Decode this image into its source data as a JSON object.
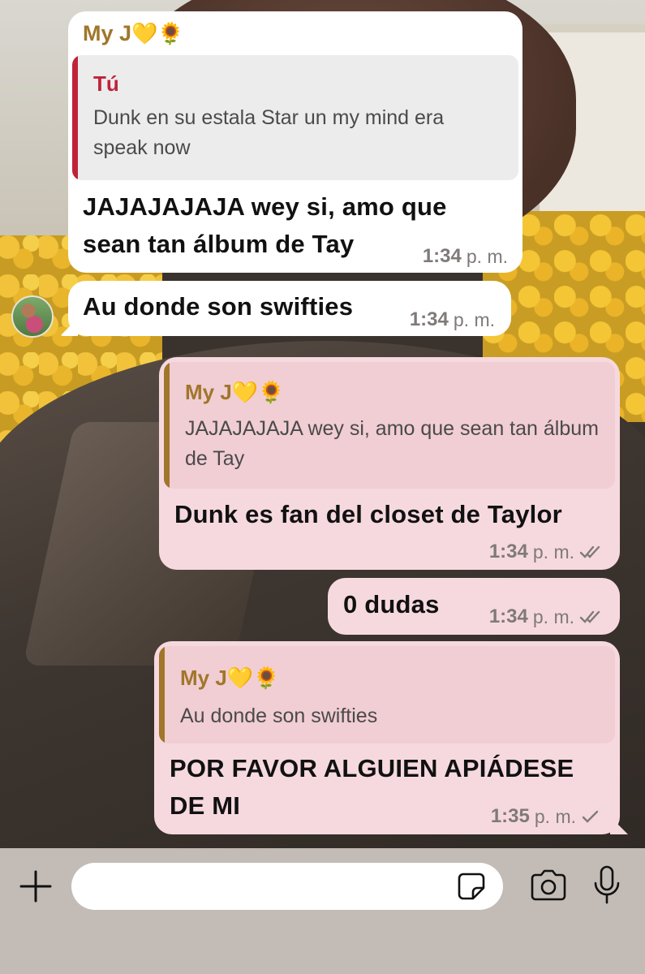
{
  "chat": {
    "messages": [
      {
        "direction": "incoming",
        "sender": "My J",
        "sender_emoji": "💛🌻",
        "quote": {
          "name": "Tú",
          "text": "Dunk en su estala Star un my mind era speak now"
        },
        "text": "JAJAJAJAJA wey si, amo que sean tan álbum de Tay",
        "time": "1:34",
        "ampm": "p. m."
      },
      {
        "direction": "incoming",
        "text": "Au donde son swifties",
        "time": "1:34",
        "ampm": "p. m."
      },
      {
        "direction": "outgoing",
        "quote": {
          "name": "My J",
          "name_emoji": "💛🌻",
          "text": "JAJAJAJAJA wey si, amo que sean tan álbum de Tay"
        },
        "text": "Dunk es fan del closet de Taylor",
        "time": "1:34",
        "ampm": "p. m.",
        "status": "read"
      },
      {
        "direction": "outgoing",
        "text": "0 dudas",
        "time": "1:34",
        "ampm": "p. m.",
        "status": "read"
      },
      {
        "direction": "outgoing",
        "quote": {
          "name": "My J",
          "name_emoji": "💛🌻",
          "text": "Au donde son swifties"
        },
        "text": "POR FAVOR ALGUIEN APIÁDESE DE MI",
        "time": "1:35",
        "ampm": "p. m.",
        "status": "sent"
      }
    ]
  },
  "input_bar": {
    "placeholder": "",
    "icons": [
      "plus-icon",
      "sticker-icon",
      "camera-icon",
      "microphone-icon"
    ]
  },
  "colors": {
    "incoming_bubble": "#ffffff",
    "outgoing_bubble": "#f6d9df",
    "sender_name": "#a0762a",
    "self_quote_name": "#c0223a",
    "self_quote_bar": "#c0223a",
    "contact_quote_bar": "#a0762a",
    "input_bar_bg": "#c2bbb6"
  }
}
